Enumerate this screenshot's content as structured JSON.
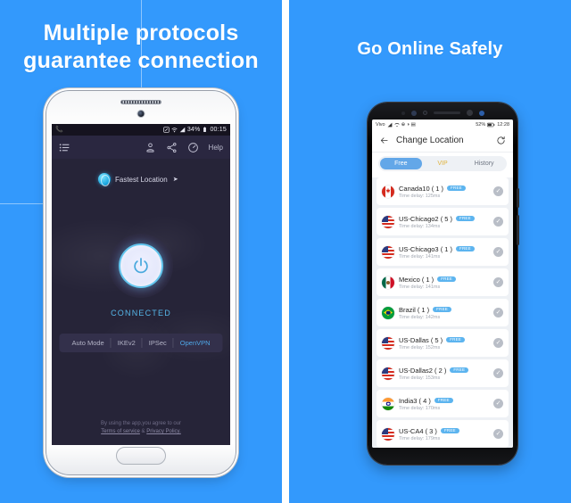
{
  "theme": {
    "panel_bg": "#3399fc",
    "accent_blue": "#4fa8e8",
    "badge_blue": "#5cb4ef",
    "vip_gold": "#e0b33c",
    "dark_screen": "#262438"
  },
  "left_panel": {
    "headline_line1": "Multiple protocols",
    "headline_line2": "guarantee connection",
    "phone": {
      "status_bar": {
        "call_icon": "phone-icon",
        "nfc_icon": "nfc-icon",
        "wifi_icon": "wifi-icon",
        "signal_icon": "signal-icon",
        "battery_percent": "34%",
        "battery_icon": "battery-icon",
        "clock": "00:15"
      },
      "toolbar": {
        "menu_icon": "list-menu-icon",
        "account_icon": "account-icon",
        "share_icon": "share-icon",
        "speed_icon": "speedometer-icon",
        "help_label": "Help"
      },
      "fastest_location": {
        "icon": "globe-icon",
        "label": "Fastest Location",
        "arrow": "➤"
      },
      "power_button": {
        "icon": "power-icon"
      },
      "status_label": "CONNECTED",
      "protocols": [
        {
          "label": "Auto Mode",
          "active": false
        },
        {
          "label": "IKEv2",
          "active": false
        },
        {
          "label": "IPSec",
          "active": false
        },
        {
          "label": "OpenVPN",
          "active": true
        }
      ],
      "legal_line1": "By using the app,you agree to our",
      "legal_terms": "Terms of service",
      "legal_amp": " & ",
      "legal_privacy": "Privacy Policy."
    }
  },
  "right_panel": {
    "headline": "Go Online Safely",
    "phone": {
      "status_bar": {
        "carrier": "Vivo",
        "signal_icon": "signal-icon",
        "wifi_icon": "wifi-icon",
        "icons": "⊕ ◑ ▤",
        "battery_percent": "52%",
        "clock": "12:28"
      },
      "appbar": {
        "back_icon": "back-arrow-icon",
        "title": "Change Location",
        "refresh_icon": "refresh-icon"
      },
      "tabs": [
        {
          "label": "Free",
          "state": "active"
        },
        {
          "label": "VIP",
          "state": "vip"
        },
        {
          "label": "History",
          "state": "normal"
        }
      ],
      "delay_prefix": "Time delay: ",
      "badge_label": "FREE",
      "check_glyph": "✓",
      "servers": [
        {
          "name": "Canada10 ( 1 )",
          "delay": "125ms",
          "badge": "FREE",
          "flag": "ca"
        },
        {
          "name": "US-Chicago2 ( 5 )",
          "delay": "134ms",
          "badge": "FREE",
          "flag": "us"
        },
        {
          "name": "US-Chicago3 ( 1 )",
          "delay": "141ms",
          "badge": "FREE",
          "flag": "us"
        },
        {
          "name": "Mexico ( 1 )",
          "delay": "141ms",
          "badge": "FREE",
          "flag": "mx"
        },
        {
          "name": "Brazil ( 1 )",
          "delay": "142ms",
          "badge": "FREE",
          "flag": "br"
        },
        {
          "name": "US-Dallas ( 5 )",
          "delay": "152ms",
          "badge": "FREE",
          "flag": "us"
        },
        {
          "name": "US-Dallas2 ( 2 )",
          "delay": "153ms",
          "badge": "FREE",
          "flag": "us"
        },
        {
          "name": "India3 ( 4 )",
          "delay": "170ms",
          "badge": "FREE",
          "flag": "in"
        },
        {
          "name": "US-CA4 ( 3 )",
          "delay": "179ms",
          "badge": "FREE",
          "flag": "us"
        }
      ]
    }
  }
}
